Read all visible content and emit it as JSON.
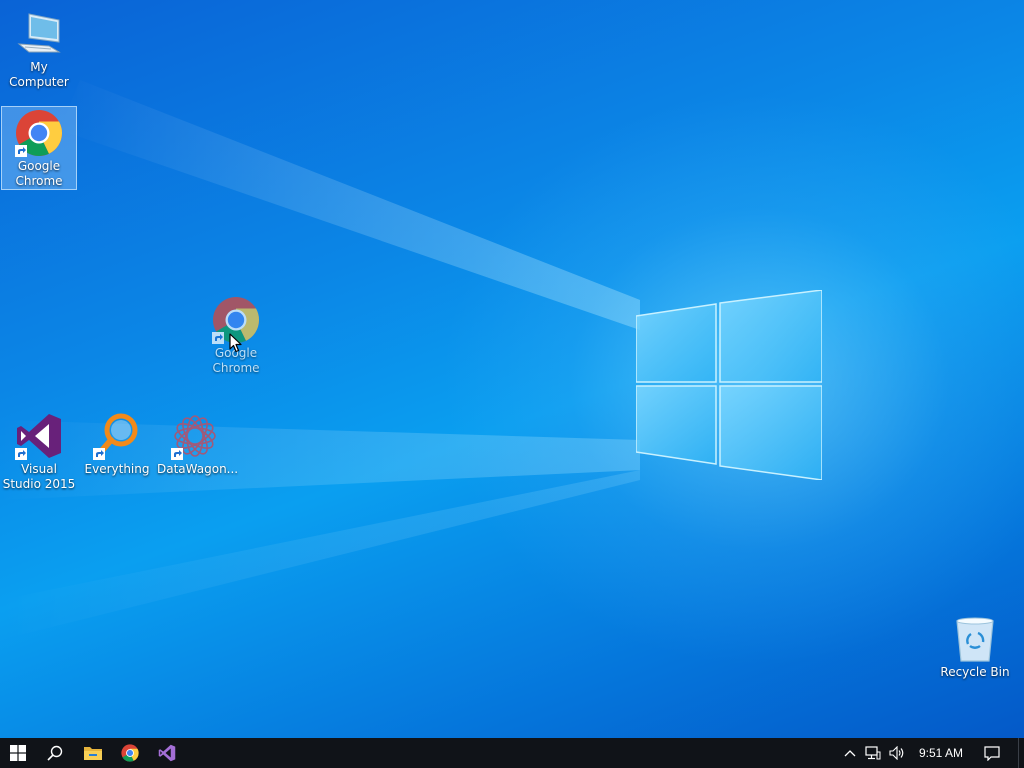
{
  "desktop": {
    "icons": [
      {
        "label": "My Computer",
        "icon": "computer-icon"
      },
      {
        "label": "Google Chrome",
        "icon": "chrome-icon",
        "selected": true
      },
      {
        "label": "Google Chrome",
        "icon": "chrome-icon",
        "dragging": true
      },
      {
        "label": "Visual Studio 2015",
        "icon": "visual-studio-icon"
      },
      {
        "label": "Everything",
        "icon": "everything-search-icon"
      },
      {
        "label": "DataWagon...",
        "icon": "datawagon-icon"
      },
      {
        "label": "Recycle Bin",
        "icon": "recycle-bin-icon"
      }
    ]
  },
  "taskbar": {
    "start": "windows-start-icon",
    "search": "search-icon",
    "pinned": [
      {
        "name": "File Explorer",
        "icon": "file-explorer-icon"
      },
      {
        "name": "Google Chrome",
        "icon": "chrome-icon"
      },
      {
        "name": "Visual Studio",
        "icon": "visual-studio-icon"
      }
    ],
    "tray": {
      "chevron": "chevron-up-icon",
      "network": "network-icon",
      "volume": "volume-icon",
      "clock": "9:51 AM",
      "notifications": "action-center-icon"
    }
  },
  "colors": {
    "desktop_blue": "#0b86e6",
    "taskbar": "#101318",
    "selection": "#aad7ff"
  }
}
